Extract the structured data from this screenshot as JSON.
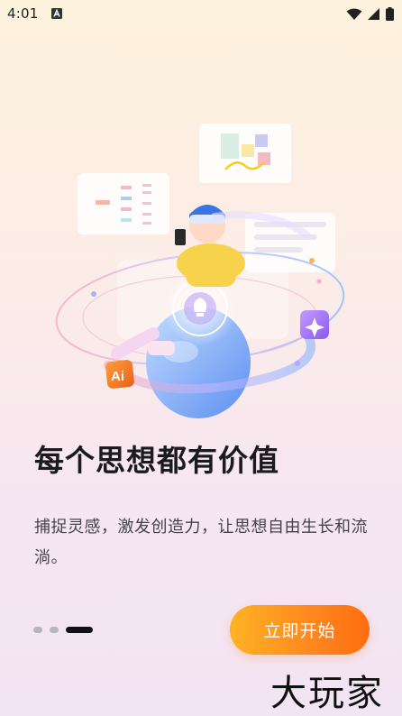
{
  "status_bar": {
    "time": "4:01",
    "app_icon": "a-letter-notification-icon",
    "icons": [
      "wifi-icon",
      "signal-icon",
      "battery-icon"
    ]
  },
  "onboarding": {
    "headline": "每个思想都有价值",
    "subtitle": "捕捉灵感，激发创造力，让思想自由生长和流淌。",
    "page_count": 3,
    "active_page": 3,
    "start_button": "立即开始",
    "ai_badge": "Ai"
  },
  "watermark": "大玩家",
  "colors": {
    "accent_start": "#ffb224",
    "accent_end": "#ff6d10",
    "headline": "#1b1b1f"
  }
}
